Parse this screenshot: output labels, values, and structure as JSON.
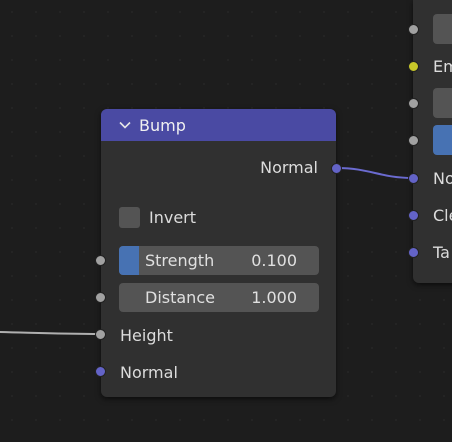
{
  "bump_node": {
    "title": "Bump",
    "output_normal": "Normal",
    "invert_label": "Invert",
    "strength": {
      "label": "Strength",
      "value": "0.100",
      "fill_fraction": 0.1
    },
    "distance": {
      "label": "Distance",
      "value": "1.000"
    },
    "height_label": "Height",
    "normal_label": "Normal"
  },
  "right_node": {
    "labels": [
      "Em",
      "No",
      "Cle",
      "Ta"
    ]
  },
  "colors": {
    "header": "#4a4aa3",
    "node_body": "#303030",
    "vector_socket": "#6363c7",
    "float_socket": "#a1a1a1",
    "color_socket": "#c7c729",
    "slider_fill": "#4772b3"
  }
}
